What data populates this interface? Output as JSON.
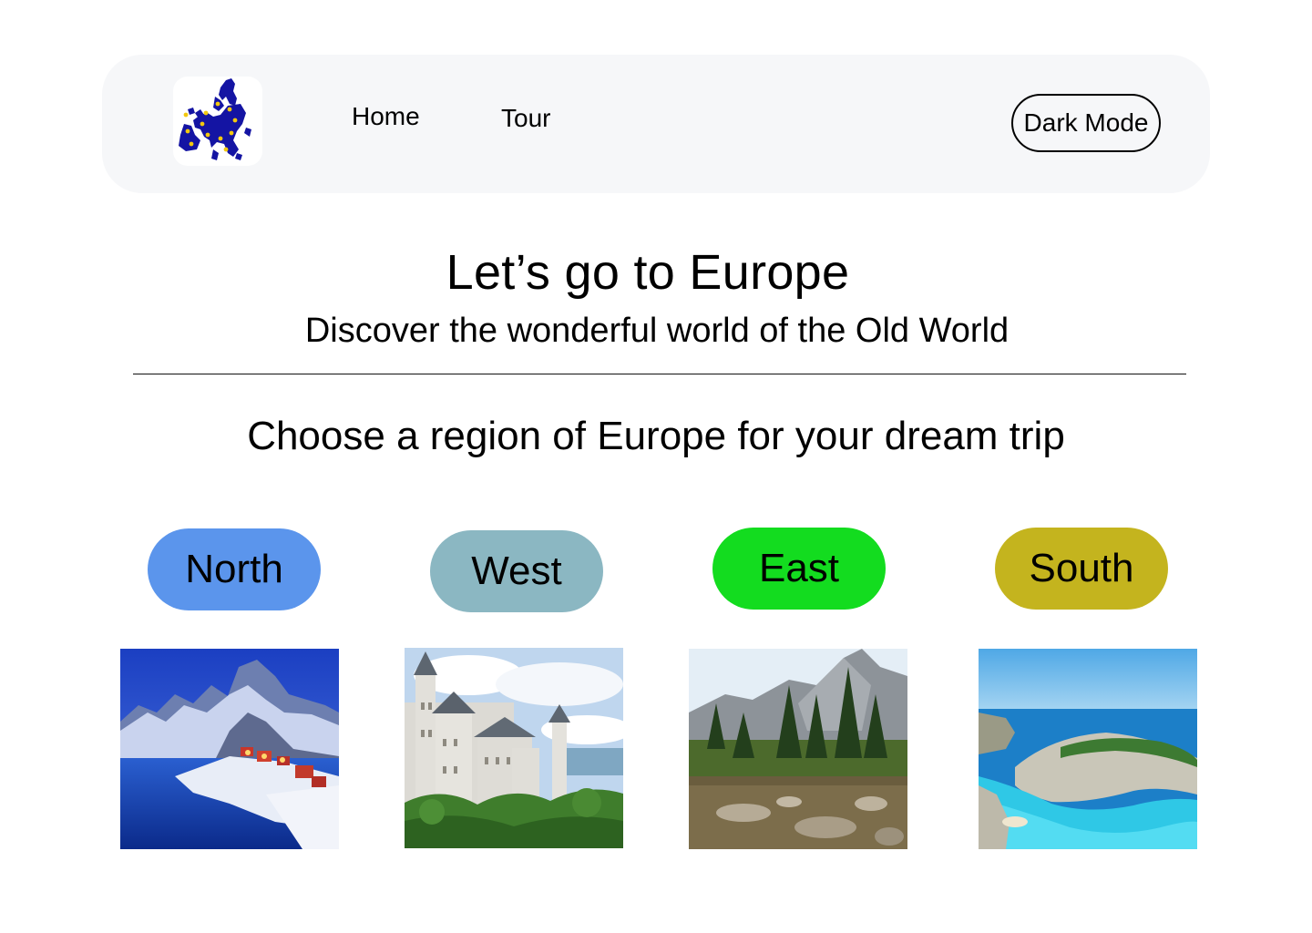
{
  "nav": {
    "logo_icon": "europe-map-icon",
    "links": [
      {
        "label": "Home"
      },
      {
        "label": "Tour"
      }
    ],
    "dark_mode_label": "Dark Mode"
  },
  "hero": {
    "title": "Let’s go to Europe",
    "subtitle": "Discover the wonderful world of the Old World"
  },
  "section": {
    "heading": "Choose a region of Europe for your dream trip"
  },
  "regions": [
    {
      "label": "North",
      "color": "#5b95ec",
      "image": "snowy-fjord-village-photo"
    },
    {
      "label": "West",
      "color": "#8bb7c2",
      "image": "castle-photo"
    },
    {
      "label": "East",
      "color": "#13dc1f",
      "image": "mountain-lake-photo"
    },
    {
      "label": "South",
      "color": "#c4b41e",
      "image": "turquoise-bay-cliff-photo"
    }
  ]
}
